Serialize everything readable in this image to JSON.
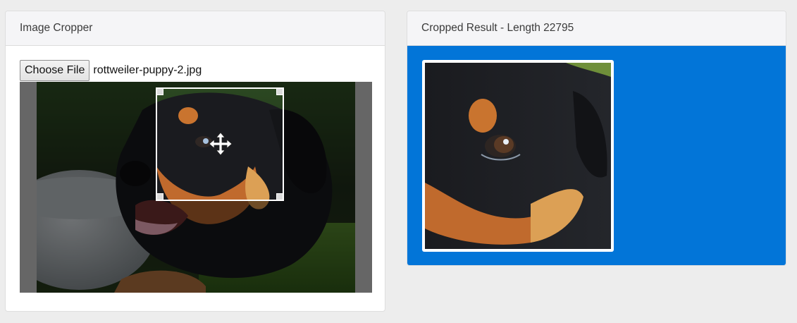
{
  "left_panel": {
    "title": "Image Cropper",
    "choose_file_label": "Choose File",
    "file_name": "rottweiler-puppy-2.jpg"
  },
  "right_panel": {
    "title": "Cropped Result - Length 22795"
  },
  "cropper": {
    "move_cursor_icon": "move-arrows-icon"
  },
  "colors": {
    "page_background": "#ededed",
    "result_background": "#0275d8",
    "crop_frame": "#ffffff"
  }
}
